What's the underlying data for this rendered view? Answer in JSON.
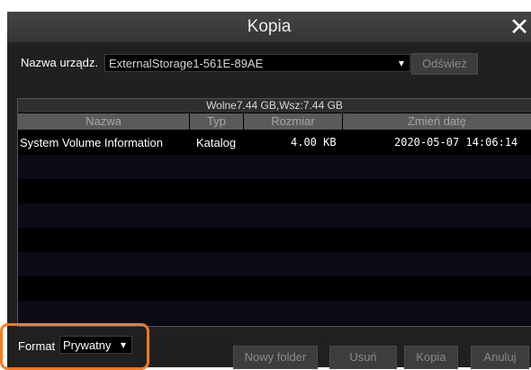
{
  "window": {
    "title": "Kopia",
    "close_icon": "close-icon"
  },
  "device": {
    "label": "Nazwa urządz.",
    "selected": "ExternalStorage1-561E-89AE",
    "refresh_label": "Odśwież"
  },
  "storage": {
    "free_space": "Wolne7.44 GB,Wsz:7.44 GB"
  },
  "table": {
    "columns": [
      "Nazwa",
      "Typ",
      "Rozmiar",
      "Zmień datę"
    ],
    "rows": [
      {
        "name": "System Volume Information",
        "type": "Katalog",
        "size": "4.00 KB",
        "date": "2020-05-07 14:06:14"
      }
    ]
  },
  "footer": {
    "format_label": "Format",
    "format_value": "Prywatny",
    "buttons": {
      "new_folder": "Nowy folder",
      "delete": "Usuń",
      "copy": "Kopia",
      "cancel": "Anuluj"
    }
  },
  "colors": {
    "highlight": "#ff7a1a",
    "title_bar": "#3d3d3d",
    "background": "#202020"
  }
}
